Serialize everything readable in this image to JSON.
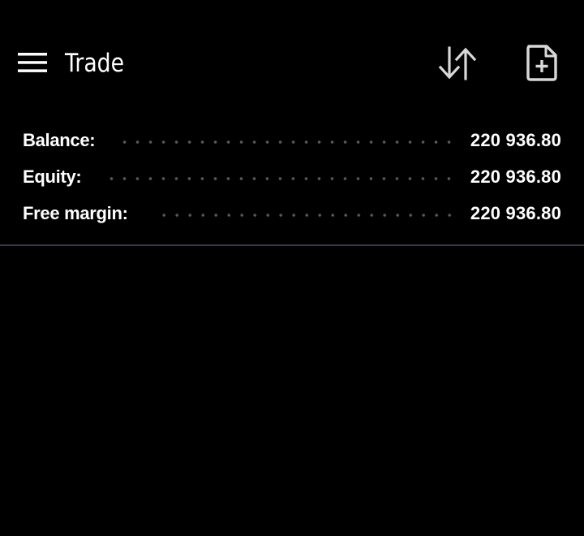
{
  "header": {
    "title": "Trade",
    "menu_icon": "hamburger-menu-icon",
    "sort_icon": "sort-arrows-icon",
    "new_order_icon": "new-document-plus-icon"
  },
  "summary": {
    "rows": [
      {
        "label": "Balance:",
        "value": "220 936.80"
      },
      {
        "label": "Equity:",
        "value": "220 936.80"
      },
      {
        "label": "Free margin:",
        "value": "220 936.80"
      }
    ]
  },
  "colors": {
    "background": "#000000",
    "text": "#ffffff",
    "icon": "#d8d8d8",
    "divider": "#3a3a44",
    "dots": "#5a5a5a"
  }
}
